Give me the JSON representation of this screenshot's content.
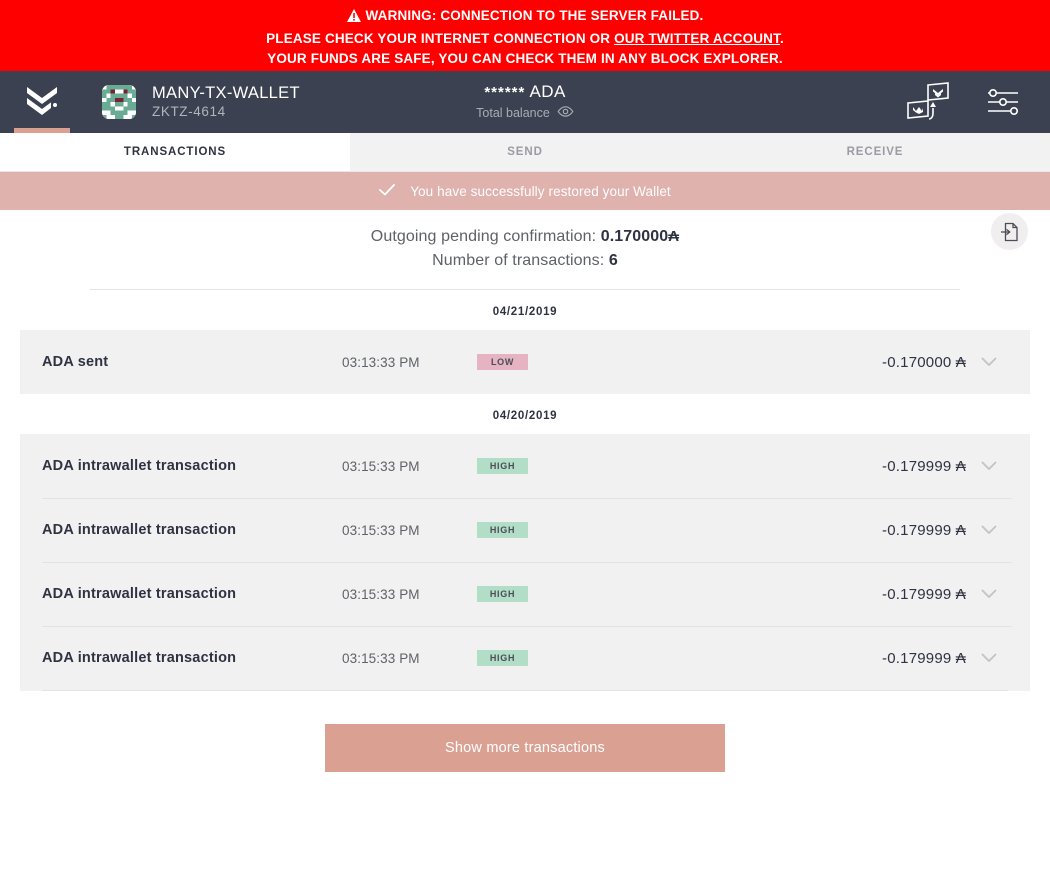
{
  "warning": {
    "icon": "warning-triangle-icon",
    "line1": "WARNING: CONNECTION TO THE SERVER FAILED.",
    "line2_prefix": "PLEASE CHECK YOUR INTERNET CONNECTION OR ",
    "line2_link": "OUR TWITTER ACCOUNT",
    "line2_suffix": ".",
    "line3": "YOUR FUNDS ARE SAFE, YOU CAN CHECK THEM IN ANY BLOCK EXPLORER.",
    "background_color": "#ff0000",
    "text_color": "#ffffff"
  },
  "topbar": {
    "background_color": "#3b4150",
    "logo_icon": "daedalus-chevron-logo-icon",
    "logo_indicator_color": "#daa193",
    "wallet": {
      "avatar_icon": "wallet-identicon-avatar",
      "name": "MANY-TX-WALLET",
      "id": "ZKTZ-4614"
    },
    "balance": {
      "amount_masked": "******",
      "currency": "ADA",
      "label": "Total balance",
      "visibility_icon": "eye-icon"
    },
    "actions": [
      {
        "name": "wallet-switch-icon",
        "label": "Switch wallet"
      },
      {
        "name": "settings-sliders-icon",
        "label": "Settings"
      }
    ]
  },
  "tabs": [
    {
      "label": "TRANSACTIONS",
      "active": true
    },
    {
      "label": "SEND",
      "active": false
    },
    {
      "label": "RECEIVE",
      "active": false
    }
  ],
  "notification": {
    "icon": "checkmark-icon",
    "message": "You have successfully restored your Wallet",
    "background_color": "#dfb2ae"
  },
  "summary": {
    "pending_label": "Outgoing pending confirmation:",
    "pending_value": "0.170000",
    "pending_currency": "₳",
    "count_label": "Number of transactions:",
    "count_value": "6",
    "export_icon": "export-file-icon"
  },
  "transaction_groups": [
    {
      "date": "04/21/2019",
      "transactions": [
        {
          "title": "ADA sent",
          "time": "03:13:33 PM",
          "badge": "LOW",
          "badge_type": "low",
          "amount": "-0.170000",
          "currency": "₳",
          "expand_icon": "chevron-down-icon"
        }
      ]
    },
    {
      "date": "04/20/2019",
      "transactions": [
        {
          "title": "ADA intrawallet transaction",
          "time": "03:15:33 PM",
          "badge": "HIGH",
          "badge_type": "high",
          "amount": "-0.179999",
          "currency": "₳",
          "expand_icon": "chevron-down-icon"
        },
        {
          "title": "ADA intrawallet transaction",
          "time": "03:15:33 PM",
          "badge": "HIGH",
          "badge_type": "high",
          "amount": "-0.179999",
          "currency": "₳",
          "expand_icon": "chevron-down-icon"
        },
        {
          "title": "ADA intrawallet transaction",
          "time": "03:15:33 PM",
          "badge": "HIGH",
          "badge_type": "high",
          "amount": "-0.179999",
          "currency": "₳",
          "expand_icon": "chevron-down-icon"
        },
        {
          "title": "ADA intrawallet transaction",
          "time": "03:15:33 PM",
          "badge": "HIGH",
          "badge_type": "high",
          "amount": "-0.179999",
          "currency": "₳",
          "expand_icon": "chevron-down-icon"
        }
      ]
    }
  ],
  "show_more": {
    "label": "Show more transactions",
    "background_color": "#daa193"
  },
  "colors": {
    "badge_low": "#e5b3c2",
    "badge_high": "#b2ddc6",
    "row_background": "#f1f1f2",
    "accent": "#daa193"
  }
}
